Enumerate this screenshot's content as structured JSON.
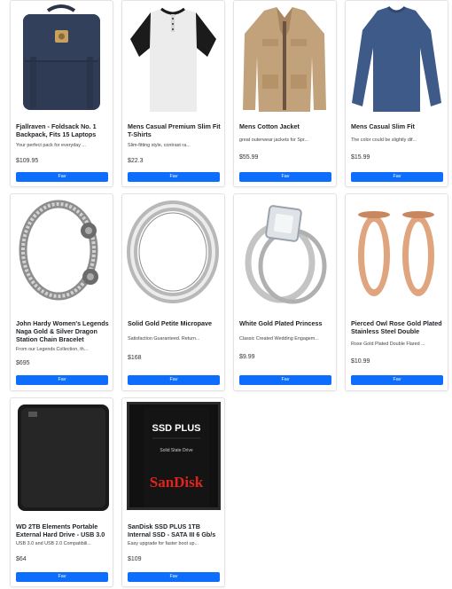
{
  "products": [
    {
      "title": "Fjallraven - Foldsack No. 1 Backpack, Fits 15 Laptops",
      "description": "Your perfect pack for everyday ...",
      "price": "$109.95",
      "button": "Fav"
    },
    {
      "title": "Mens Casual Premium Slim Fit T-Shirts",
      "description": "Slim-fitting style, contrast ra...",
      "price": "$22.3",
      "button": "Fav"
    },
    {
      "title": "Mens Cotton Jacket",
      "description": "great outerwear jackets for Spr...",
      "price": "$55.99",
      "button": "Fav"
    },
    {
      "title": "Mens Casual Slim Fit",
      "description": "The color could be slightly dif...",
      "price": "$15.99",
      "button": "Fav"
    },
    {
      "title": "John Hardy Women's Legends Naga Gold & Silver Dragon Station Chain Bracelet",
      "description": "From our Legends Collection, th...",
      "price": "$695",
      "button": "Fav"
    },
    {
      "title": "Solid Gold Petite Micropave",
      "description": "Satisfaction Guaranteed. Return...",
      "price": "$168",
      "button": "Fav"
    },
    {
      "title": "White Gold Plated Princess",
      "description": "Classic Created Wedding Engagem...",
      "price": "$9.99",
      "button": "Fav"
    },
    {
      "title": "Pierced Owl Rose Gold Plated Stainless Steel Double",
      "description": "Rose Gold Plated Double Flared ...",
      "price": "$10.99",
      "button": "Fav"
    },
    {
      "title": "WD 2TB Elements Portable External Hard Drive - USB 3.0",
      "description": "USB 3.0 and USB 2.0 Compatibili...",
      "price": "$64",
      "button": "Fav"
    },
    {
      "title": "SanDisk SSD PLUS 1TB Internal SSD - SATA III 6 Gb/s",
      "description": "Easy upgrade for faster boot up...",
      "price": "$109",
      "button": "Fav"
    }
  ],
  "images": {
    "ssd_brand": "SSD PLUS",
    "ssd_sub": "Solid State Drive",
    "ssd_logo": "SanDisk"
  },
  "colors": {
    "button_bg": "#0d6efd",
    "button_text": "#ffffff"
  }
}
